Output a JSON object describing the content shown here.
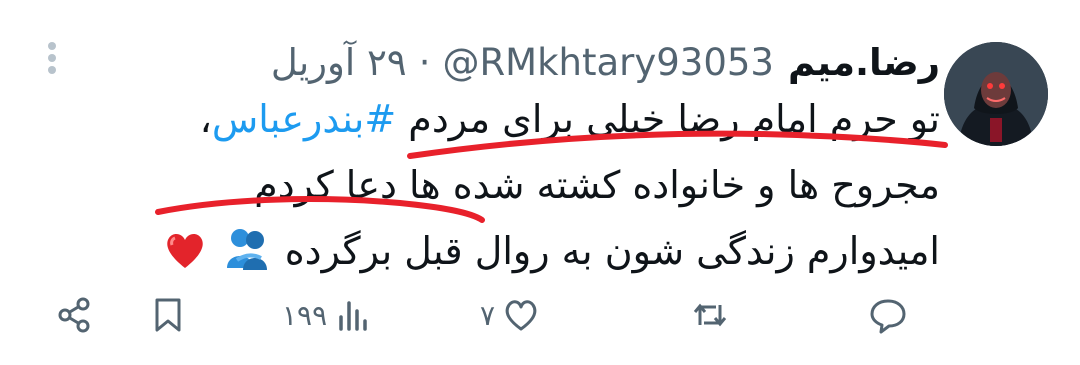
{
  "tweet": {
    "display_name": "رضا.میم",
    "handle": "@RMkhtary93053",
    "separator": "·",
    "date": "۲۹ آوریل",
    "text": {
      "line1_prefix": "تو حرم امام رضا خیلی برای مردم",
      "line1_hashtag": "#بندرعباس",
      "line1_suffix": "،",
      "line2": "مجروح ها و خانواده کشته شده ها دعا کردم",
      "line3": "امیدوارم زندگی شون به روال قبل برگرده"
    },
    "emojis": [
      "people-hugging",
      "red-heart"
    ]
  },
  "actions": {
    "views_count": "۱۹۹",
    "likes_count": "۷"
  },
  "colors": {
    "text": "#0f1419",
    "secondary": "#536471",
    "hashtag": "#1d9bf0",
    "annotation": "#e8212b"
  }
}
